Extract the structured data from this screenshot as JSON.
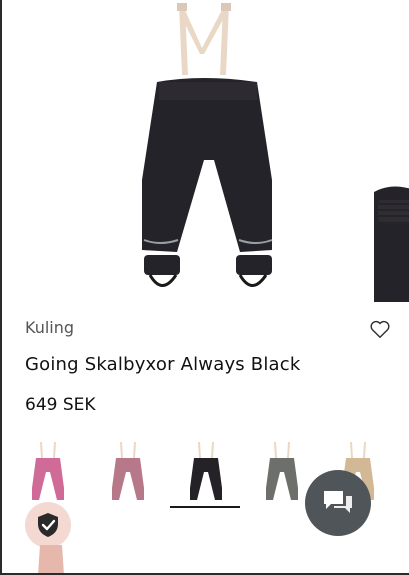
{
  "product": {
    "brand": "Kuling",
    "title": "Going Skalbyxor Always Black",
    "price": "649 SEK"
  },
  "icons": {
    "wishlist": "heart-icon",
    "trust": "shield-check-icon",
    "chat": "chat-icon"
  },
  "variants": [
    {
      "color": "#d06a97",
      "selected": false
    },
    {
      "color": "#b7788a",
      "selected": false
    },
    {
      "color": "#242227",
      "selected": true
    },
    {
      "color": "#6d706a",
      "selected": false
    },
    {
      "color": "#d3b896",
      "selected": false
    }
  ],
  "colors": {
    "pant": "#25232a",
    "suspender": "#ead8c6",
    "chat_bg": "#4f5559",
    "badge_bg": "#f3d9d2"
  }
}
